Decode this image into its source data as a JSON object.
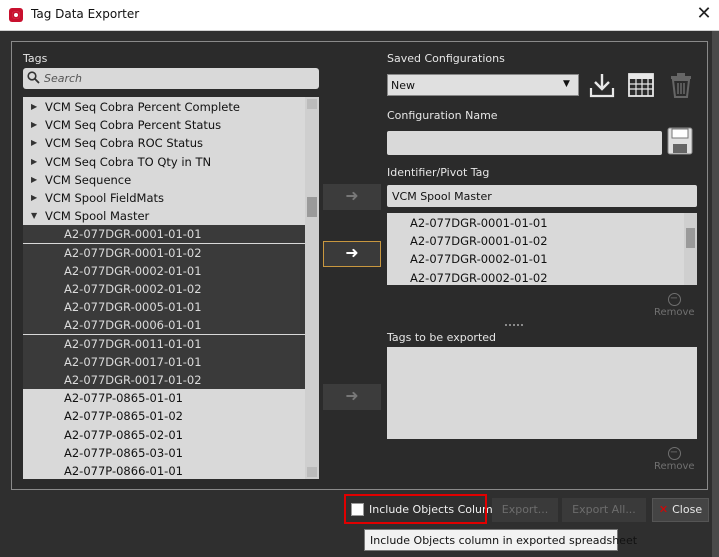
{
  "window": {
    "title": "Tag Data Exporter",
    "close_glyph": "✕"
  },
  "tags": {
    "label": "Tags",
    "search_placeholder": "Search",
    "tree": [
      {
        "text": "VCM Seq Cobra Percent Complete",
        "caret": "▶",
        "level": 0,
        "selected": false
      },
      {
        "text": "VCM Seq Cobra Percent Status",
        "caret": "▶",
        "level": 0,
        "selected": false
      },
      {
        "text": "VCM Seq Cobra ROC Status",
        "caret": "▶",
        "level": 0,
        "selected": false
      },
      {
        "text": "VCM Seq Cobra TO Qty in TN",
        "caret": "▶",
        "level": 0,
        "selected": false
      },
      {
        "text": "VCM Sequence",
        "caret": "▶",
        "level": 0,
        "selected": false
      },
      {
        "text": "VCM Spool FieldMats",
        "caret": "▶",
        "level": 0,
        "selected": false
      },
      {
        "text": "VCM Spool Master",
        "caret": "▼",
        "level": 0,
        "selected": false
      },
      {
        "text": "A2-077DGR-0001-01-01",
        "caret": "",
        "level": 1,
        "selected": true
      },
      {
        "text": "A2-077DGR-0001-01-02",
        "caret": "",
        "level": 1,
        "selected": true
      },
      {
        "text": "A2-077DGR-0002-01-01",
        "caret": "",
        "level": 1,
        "selected": true
      },
      {
        "text": "A2-077DGR-0002-01-02",
        "caret": "",
        "level": 1,
        "selected": true
      },
      {
        "text": "A2-077DGR-0005-01-01",
        "caret": "",
        "level": 1,
        "selected": true
      },
      {
        "text": "A2-077DGR-0006-01-01",
        "caret": "",
        "level": 1,
        "selected": true
      },
      {
        "text": "A2-077DGR-0011-01-01",
        "caret": "",
        "level": 1,
        "selected": true
      },
      {
        "text": "A2-077DGR-0017-01-01",
        "caret": "",
        "level": 1,
        "selected": true
      },
      {
        "text": "A2-077DGR-0017-01-02",
        "caret": "",
        "level": 1,
        "selected": true
      },
      {
        "text": "A2-077P-0865-01-01",
        "caret": "",
        "level": 1,
        "selected": false
      },
      {
        "text": "A2-077P-0865-01-02",
        "caret": "",
        "level": 1,
        "selected": false
      },
      {
        "text": "A2-077P-0865-02-01",
        "caret": "",
        "level": 1,
        "selected": false
      },
      {
        "text": "A2-077P-0865-03-01",
        "caret": "",
        "level": 1,
        "selected": false
      },
      {
        "text": "A2-077P-0866-01-01",
        "caret": "",
        "level": 1,
        "selected": false
      }
    ]
  },
  "middle": {
    "set_pivot_arrow": "➜",
    "add_arrow": "➜",
    "add_export_arrow": "➜"
  },
  "saved": {
    "label": "Saved Configurations",
    "selected": "New",
    "icons": [
      "download-icon",
      "spreadsheet-icon",
      "trash-icon"
    ]
  },
  "config": {
    "label": "Configuration Name",
    "value": ""
  },
  "pivot": {
    "label": "Identifier/Pivot Tag",
    "value": "VCM Spool Master",
    "list": [
      "A2-077DGR-0001-01-01",
      "A2-077DGR-0001-01-02",
      "A2-077DGR-0002-01-01",
      "A2-077DGR-0002-01-02"
    ],
    "remove_label": "Remove"
  },
  "export_tags": {
    "label": "Tags to be exported",
    "remove_label": "Remove"
  },
  "footer": {
    "include_label": "Include Objects Column",
    "export_label": "Export...",
    "export_all_label": "Export All...",
    "close_label": "Close",
    "tooltip": "Include Objects column in exported spreadsheet"
  },
  "colors": {
    "highlight": "#e00000",
    "brand": "#c8102e",
    "accent_border": "#c8973f"
  }
}
